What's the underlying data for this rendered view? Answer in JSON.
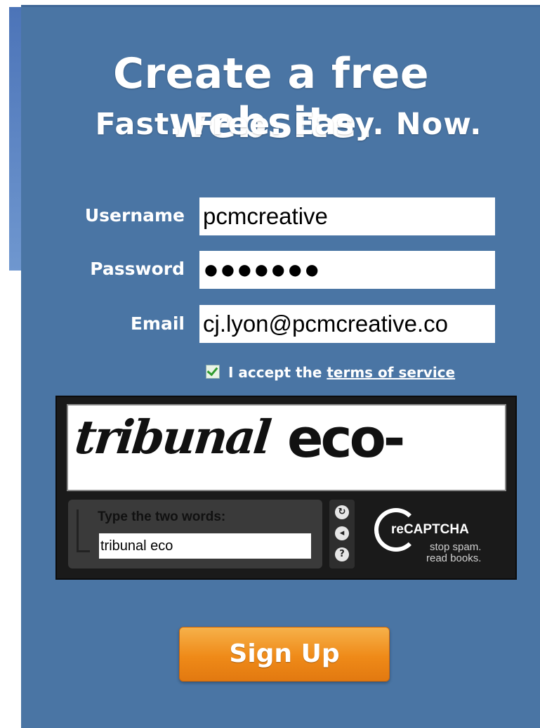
{
  "header": {
    "title": "Create a free website.",
    "subtitle": "Fast. Free. Easy. Now."
  },
  "form": {
    "username_label": "Username",
    "username_value": "pcmcreative",
    "password_label": "Password",
    "password_value": "●●●●●●●",
    "email_label": "Email",
    "email_value": "cj.lyon@pcmcreative.co",
    "tos_checked": true,
    "tos_prefix": "I accept the ",
    "tos_link": "terms of service"
  },
  "captcha": {
    "word1": "tribunal",
    "word2": "eco-",
    "prompt": "Type the two words:",
    "answer_value": "tribunal eco",
    "brand": "reCAPTCHA",
    "tagline_line1": "stop spam.",
    "tagline_line2": "read books.",
    "icons": [
      "reload-icon",
      "audio-icon",
      "help-icon"
    ]
  },
  "signup_button_label": "Sign Up",
  "colors": {
    "panel": "#4a75a4",
    "button": "#ef8a18",
    "captcha_bg": "#1a1a1a"
  }
}
